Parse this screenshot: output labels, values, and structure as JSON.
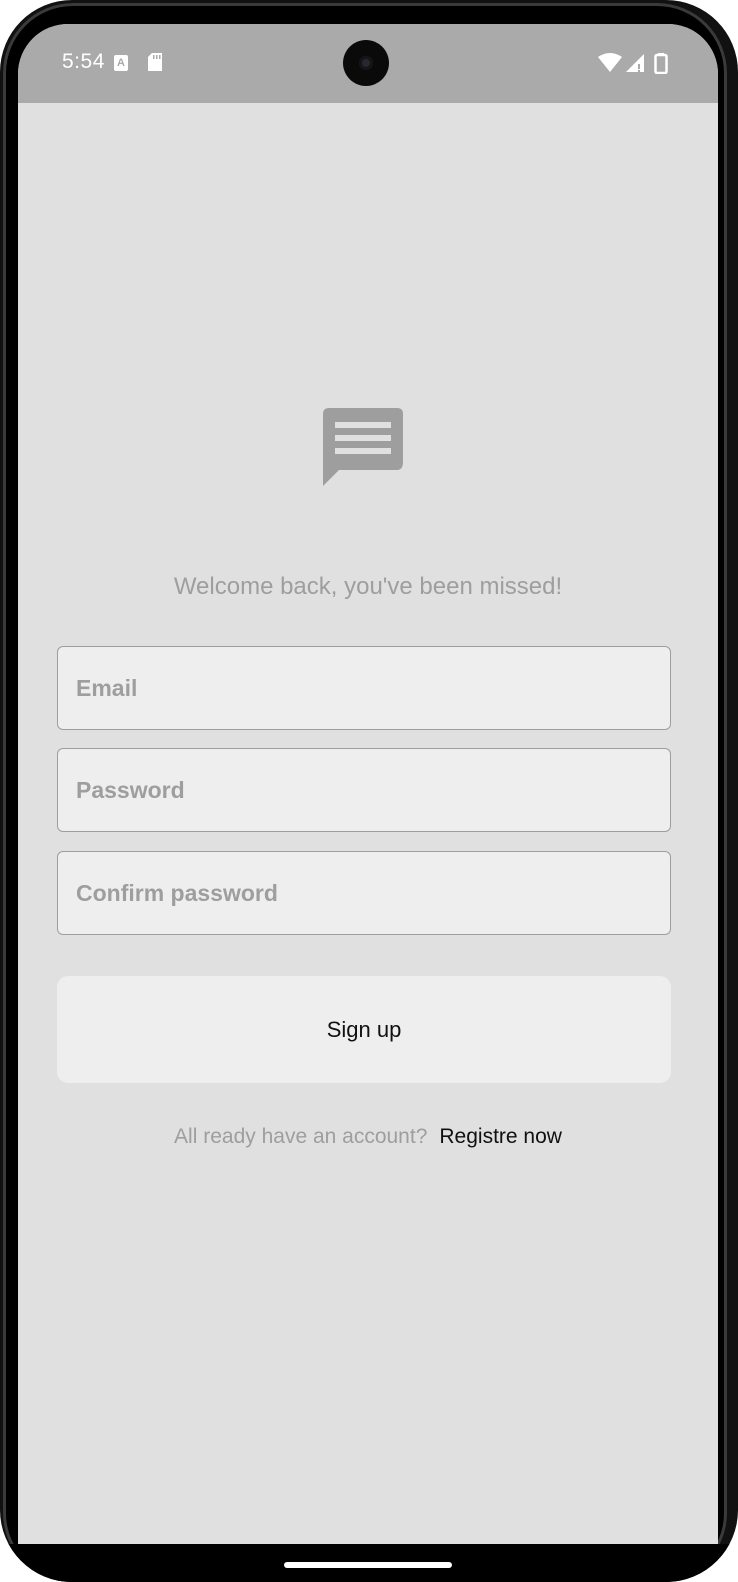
{
  "status_bar": {
    "time": "5:54",
    "left_icons": [
      "a-notification-icon",
      "sd-card-icon"
    ],
    "right_icons": [
      "wifi-icon",
      "cell-signal-icon",
      "battery-icon"
    ]
  },
  "logo": {
    "icon": "message-icon",
    "color": "#9e9e9e"
  },
  "welcome_text": "Welcome back, you've been missed!",
  "form": {
    "email_placeholder": "Email",
    "email_value": "",
    "password_placeholder": "Password",
    "password_value": "",
    "confirm_placeholder": "Confirm password",
    "confirm_value": ""
  },
  "signup_button": {
    "label": "Sign up"
  },
  "footer": {
    "prompt": "All ready have an account?",
    "link_label": "Registre now"
  },
  "colors": {
    "background": "#e0e0e0",
    "status_bar": "#aaaaaa",
    "input_fill": "#eeeeee",
    "muted_text": "#9e9e9e",
    "primary_text": "#111111"
  }
}
